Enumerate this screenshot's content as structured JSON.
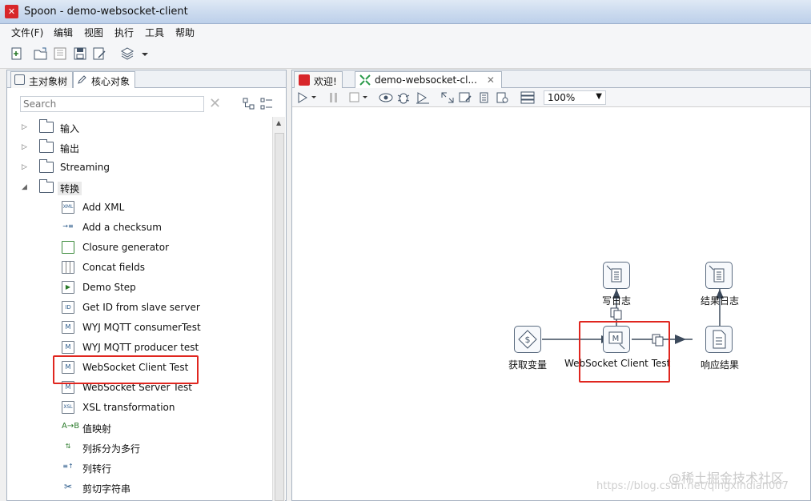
{
  "window": {
    "title": "Spoon - demo-websocket-client"
  },
  "menu": [
    "文件(F)",
    "编辑",
    "视图",
    "执行",
    "工具",
    "帮助"
  ],
  "left_panel": {
    "tabs": [
      "主对象树",
      "核心对象"
    ],
    "search": {
      "placeholder": "Search"
    },
    "folders": [
      "输入",
      "输出",
      "Streaming",
      "转换"
    ],
    "steps": [
      "Add XML",
      "Add a checksum",
      "Closure generator",
      "Concat fields",
      "Demo Step",
      "Get ID from slave server",
      "WYJ MQTT consumerTest",
      "WYJ MQTT producer test",
      "WebSocket Client Test",
      "WebSocket Server Test",
      "XSL transformation",
      "值映射",
      "列拆分为多行",
      "列转行",
      "剪切字符串"
    ]
  },
  "editor": {
    "tabs": [
      "欢迎!",
      "demo-websocket-cl..."
    ],
    "zoom": "100%",
    "nodes": [
      "获取变量",
      "WebSocket Client Test",
      "响应结果",
      "写日志",
      "结果日志"
    ]
  },
  "watermark": {
    "line1": "@稀土掘金技术社区",
    "line2": "https://blog.csdn.net/qingxindian007"
  },
  "colors": {
    "highlight": "#e0261f",
    "accent": "#2a5a8a"
  }
}
